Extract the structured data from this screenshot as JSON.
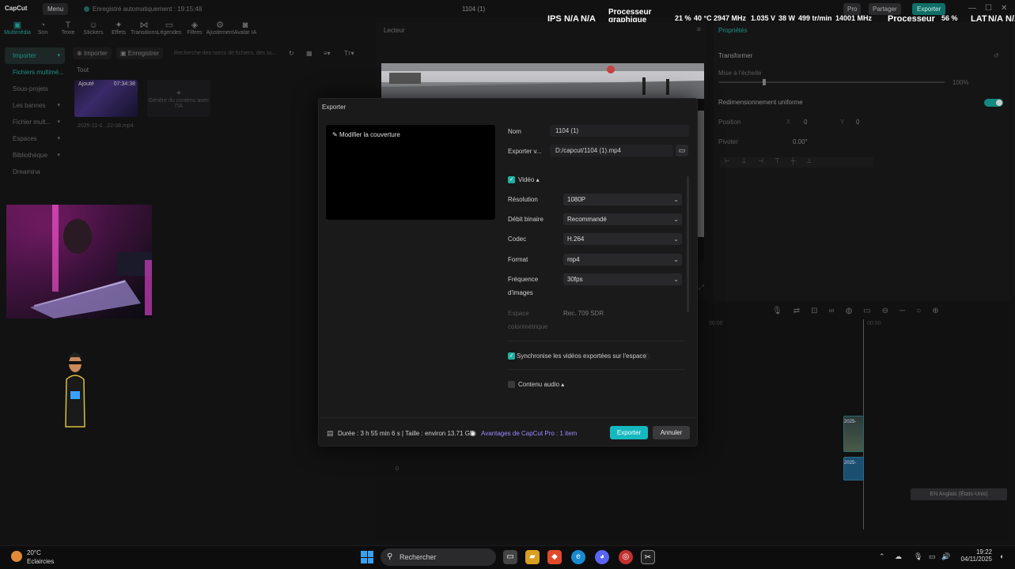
{
  "titlebar": {
    "logo": "CapCut",
    "menu": "Menu",
    "autosave": "Enregistré automatiquement : 19:15:48",
    "project": "1104 (1)",
    "pro": "Pro",
    "share": "Partager",
    "export": "Exporter"
  },
  "overlay": {
    "ips_label": "IPS",
    "ips_v1": "N/A",
    "ips_v2": "N/A",
    "gpu_line1": "Processeur",
    "gpu_line2": "graphique",
    "gpu_pct": "21 %",
    "gpu_temp": "40 °C",
    "gpu_mhz": "2947 MHz",
    "gpu_v": "1.035 V",
    "gpu_w": "38 W",
    "gpu_rpm": "499 tr/min",
    "gpu_mem": "14001 MHz",
    "cpu_label": "Processeur",
    "cpu_pct": "56 %",
    "lat_label": "LAT",
    "lat_v1": "N/A",
    "lat_v2": "N/A"
  },
  "toolbar": [
    "Multimédia",
    "Son",
    "Texte",
    "Stickers",
    "Effets",
    "Transitions",
    "Légendes",
    "Filtres",
    "Ajustement",
    "Avatar IA"
  ],
  "sidebar": [
    "Importer",
    "Fichiers multimé...",
    "Sous-projets",
    "Les bannes",
    "Fichier mult...",
    "Espaces",
    "Bibliothèque",
    "Dreamina"
  ],
  "media": {
    "import": "Importer",
    "record": "Enregistrer",
    "search": "Recherche des noms de fichiers, des sc...",
    "tab_all": "Tout",
    "clip_tag": "Ajouté",
    "clip_duration": "07:34:38",
    "clip_name": "2025-11-0...22-08.mp4",
    "ai_gen": "Génère du contenu avec l'IA"
  },
  "player": {
    "label": "Lecteur"
  },
  "properties": {
    "title": "Propriétés",
    "transform": "Transformer",
    "scale": "Mise à l'échelle",
    "scale_value": "100%",
    "uniform": "Redimensionnement uniforme",
    "position": "Position",
    "pos_x_label": "X",
    "pos_x": "0",
    "pos_y_label": "Y",
    "pos_y": "0",
    "rotate": "Pivoter",
    "rotate_value": "0.00°"
  },
  "timeline": {
    "time_start": "00:00",
    "time_mark": "00:00",
    "clip_video": "2025-",
    "clip_audio": "2025-",
    "subtitle": "EN Anglais (États-Unis)",
    "track_count": "0"
  },
  "modal": {
    "title": "Exporter",
    "cover_label": "Modifier la couverture",
    "name_label": "Nom",
    "name_value": "1104 (1)",
    "export_to_label": "Exporter v...",
    "export_to_value": "D:/capcut/1104 (1).mp4",
    "video_label": "Vidéo",
    "resolution_label": "Résolution",
    "resolution_value": "1080P",
    "bitrate_label": "Débit binaire",
    "bitrate_value": "Recommandé",
    "codec_label": "Codec",
    "codec_value": "H.264",
    "format_label": "Format",
    "format_value": "mp4",
    "framerate_label1": "Fréquence",
    "framerate_label2": "d'images",
    "framerate_value": "30fps",
    "colorspace_label1": "Espace",
    "colorspace_label2": "colorimétrique",
    "colorspace_value": "Rec. 709 SDR",
    "sync_label": "Synchronise les vidéos exportées sur l'espace",
    "audio_label": "Contenu audio",
    "footer_info": "Durée : 3 h 55 min 6 s | Taille : environ 13.71 GB",
    "pro_benefit": "Avantages de CapCut Pro : 1 item",
    "export_button": "Exporter",
    "cancel_button": "Annuler"
  },
  "taskbar": {
    "temp": "20°C",
    "weather": "Eclaircies",
    "search": "Rechercher",
    "time": "19:22",
    "date": "04/11/2025"
  }
}
